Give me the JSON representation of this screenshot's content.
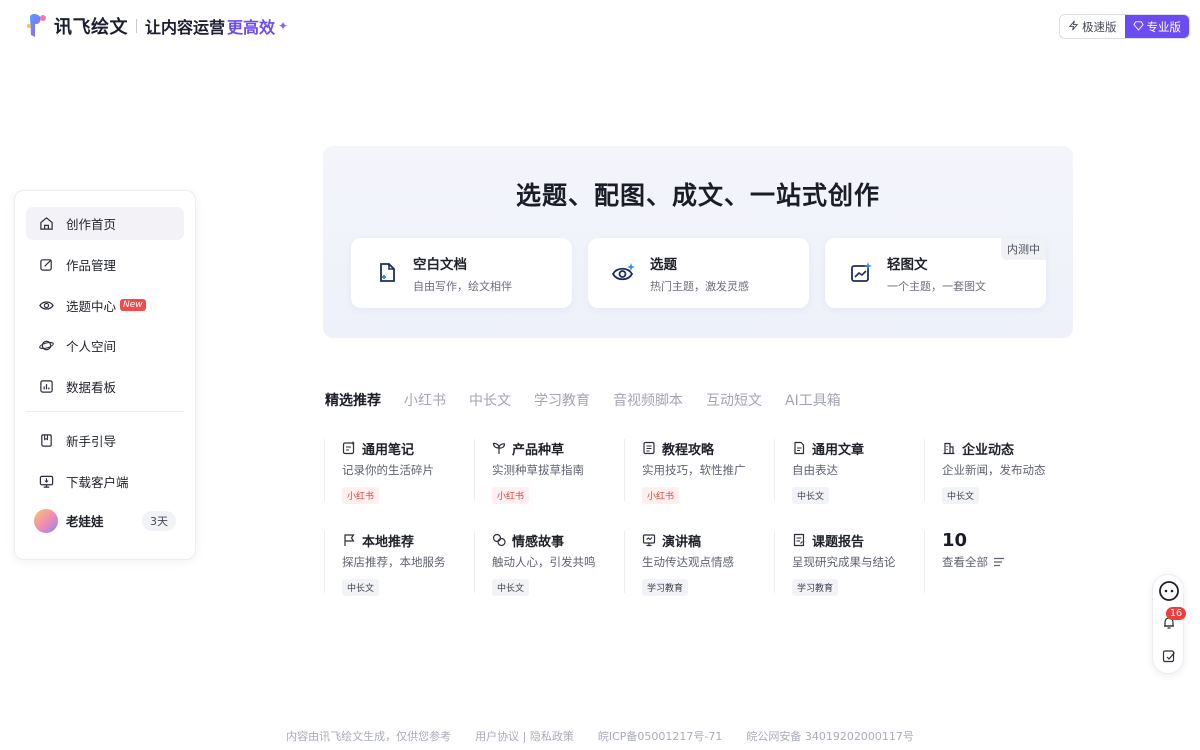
{
  "header": {
    "brand_name": "讯飞绘文",
    "slogan": "让内容运营",
    "slogan_highlight": "更高效",
    "version_fast": "极速版",
    "version_pro": "专业版",
    "colors": {
      "accent": "#6a4cf1",
      "brand_text": "#1a1d2e"
    }
  },
  "sidebar": {
    "items": [
      {
        "label": "创作首页",
        "icon": "home-icon",
        "active": true
      },
      {
        "label": "作品管理",
        "icon": "edit-icon"
      },
      {
        "label": "选题中心",
        "icon": "eye-icon",
        "badge": "New"
      },
      {
        "label": "个人空间",
        "icon": "planet-icon"
      },
      {
        "label": "数据看板",
        "icon": "bar-chart-icon"
      }
    ],
    "bottom_items": [
      {
        "label": "新手引导",
        "icon": "book-icon"
      },
      {
        "label": "下载客户端",
        "icon": "monitor-icon"
      }
    ],
    "user": {
      "name": "老娃娃",
      "days": "3天"
    }
  },
  "hero": {
    "title": "选题、配图、成文、一站式创作",
    "cards": [
      {
        "title": "空白文档",
        "subtitle": "自由写作，绘文相伴",
        "icon": "new-document-icon"
      },
      {
        "title": "选题",
        "subtitle": "热门主题，激发灵感",
        "icon": "eye-spark-icon"
      },
      {
        "title": "轻图文",
        "subtitle": "一个主题，一套图文",
        "icon": "image-chart-icon",
        "badge": "内测中"
      }
    ]
  },
  "tabs": [
    "精选推荐",
    "小红书",
    "中长文",
    "学习教育",
    "音视频脚本",
    "互动短文",
    "AI工具箱"
  ],
  "templates": [
    {
      "title": "通用笔记",
      "desc": "记录你的生活碎片",
      "tag": "小红书",
      "tag_style": "red",
      "icon": "note-icon"
    },
    {
      "title": "产品种草",
      "desc": "实测种草拔草指南",
      "tag": "小红书",
      "tag_style": "red",
      "icon": "sprout-icon"
    },
    {
      "title": "教程攻略",
      "desc": "实用技巧，软性推广",
      "tag": "小红书",
      "tag_style": "red",
      "icon": "guide-icon"
    },
    {
      "title": "通用文章",
      "desc": "自由表达",
      "tag": "中长文",
      "tag_style": "gray",
      "icon": "article-icon"
    },
    {
      "title": "企业动态",
      "desc": "企业新闻，发布动态",
      "tag": "中长文",
      "tag_style": "gray",
      "icon": "building-icon"
    },
    {
      "title": "本地推荐",
      "desc": "探店推荐，本地服务",
      "tag": "中长文",
      "tag_style": "gray",
      "icon": "flag-icon"
    },
    {
      "title": "情感故事",
      "desc": "触动人心，引发共鸣",
      "tag": "中长文",
      "tag_style": "gray",
      "icon": "heart-chat-icon"
    },
    {
      "title": "演讲稿",
      "desc": "生动传达观点情感",
      "tag": "学习教育",
      "tag_style": "gray",
      "icon": "presentation-icon"
    },
    {
      "title": "课题报告",
      "desc": "呈现研究成果与结论",
      "tag": "学习教育",
      "tag_style": "gray",
      "icon": "report-icon"
    }
  ],
  "view_all": {
    "count": "10",
    "label": "查看全部"
  },
  "float_tools": {
    "notify_count": "16"
  },
  "footer": {
    "disclaimer": "内容由讯飞绘文生成，仅供您参考",
    "links": "用户协议 | 隐私政策",
    "icp": "皖ICP备05001217号-71",
    "police": "皖公网安备 34019202000117号"
  }
}
